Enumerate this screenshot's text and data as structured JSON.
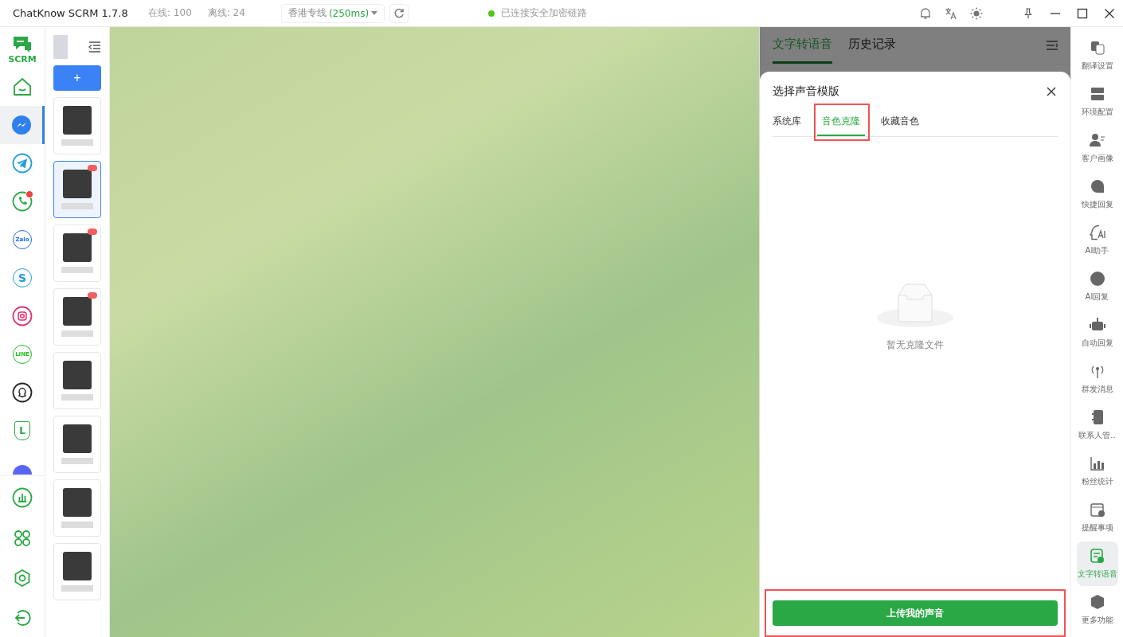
{
  "title_bar": {
    "app_title": "ChatKnow SCRM 1.7.8",
    "online": "在线: 100",
    "offline": "离线: 24",
    "line_select": {
      "name": "香港专线",
      "latency": "(250ms)"
    },
    "connection": {
      "text": "已连接安全加密链路",
      "color": "#52c41a"
    }
  },
  "app_rail": {
    "logo_text": "SCRM",
    "apps": [
      {
        "kind": "home",
        "selected": false,
        "badge": false
      },
      {
        "kind": "messenger",
        "selected": true,
        "badge": false
      },
      {
        "kind": "telegram",
        "selected": false,
        "badge": false
      },
      {
        "kind": "whatsapp",
        "selected": false,
        "badge": true
      },
      {
        "kind": "zalo",
        "glyph": "Zalo",
        "selected": false,
        "badge": false
      },
      {
        "kind": "skype",
        "glyph": "S",
        "selected": false,
        "badge": false
      },
      {
        "kind": "instagram",
        "selected": false,
        "badge": false
      },
      {
        "kind": "line",
        "glyph": "LINE",
        "selected": false,
        "badge": false
      },
      {
        "kind": "snapchat",
        "selected": false,
        "badge": false
      },
      {
        "kind": "shield",
        "glyph": "L",
        "selected": false,
        "badge": false
      },
      {
        "kind": "discord",
        "selected": false,
        "badge": false
      }
    ],
    "bottom": [
      {
        "kind": "stats"
      },
      {
        "kind": "apps"
      },
      {
        "kind": "settings"
      },
      {
        "kind": "logout"
      }
    ]
  },
  "account_list": {
    "add_button": "+",
    "accounts": [
      {
        "selected": false,
        "badge": false
      },
      {
        "selected": true,
        "badge": true
      },
      {
        "selected": false,
        "badge": true
      },
      {
        "selected": false,
        "badge": true
      },
      {
        "selected": false,
        "badge": false
      },
      {
        "selected": false,
        "badge": false
      },
      {
        "selected": false,
        "badge": false
      },
      {
        "selected": false,
        "badge": false
      }
    ]
  },
  "panel": {
    "tabs": [
      {
        "label": "文字转语音",
        "selected": true
      },
      {
        "label": "历史记录",
        "selected": false
      }
    ],
    "modal": {
      "title": "选择声音模版",
      "tabs": [
        {
          "label": "系统库",
          "selected": false,
          "highlighted": false
        },
        {
          "label": "音色克隆",
          "selected": true,
          "highlighted": true
        },
        {
          "label": "收藏音色",
          "selected": false,
          "highlighted": false
        }
      ],
      "empty_text": "暂无克隆文件",
      "upload_button": {
        "label": "上传我的声音",
        "highlighted": true
      }
    }
  },
  "tool_rail": [
    {
      "kind": "translate",
      "label": "翻译设置",
      "selected": false
    },
    {
      "kind": "server",
      "label": "环境配置",
      "selected": false
    },
    {
      "kind": "profile",
      "label": "客户画像",
      "selected": false
    },
    {
      "kind": "quick",
      "label": "快捷回复",
      "selected": false
    },
    {
      "kind": "ai-head",
      "label": "AI助手",
      "selected": false
    },
    {
      "kind": "ai",
      "label": "AI回复",
      "selected": false
    },
    {
      "kind": "robot",
      "label": "自动回复",
      "selected": false
    },
    {
      "kind": "antenna",
      "label": "群发消息",
      "selected": false
    },
    {
      "kind": "contacts",
      "label": "联系人管..",
      "selected": false
    },
    {
      "kind": "chart",
      "label": "粉丝统计",
      "selected": false
    },
    {
      "kind": "calendar",
      "label": "提醒事项",
      "selected": false
    },
    {
      "kind": "tts",
      "label": "文字转语音",
      "selected": true
    },
    {
      "kind": "cube",
      "label": "更多功能",
      "selected": false
    }
  ]
}
